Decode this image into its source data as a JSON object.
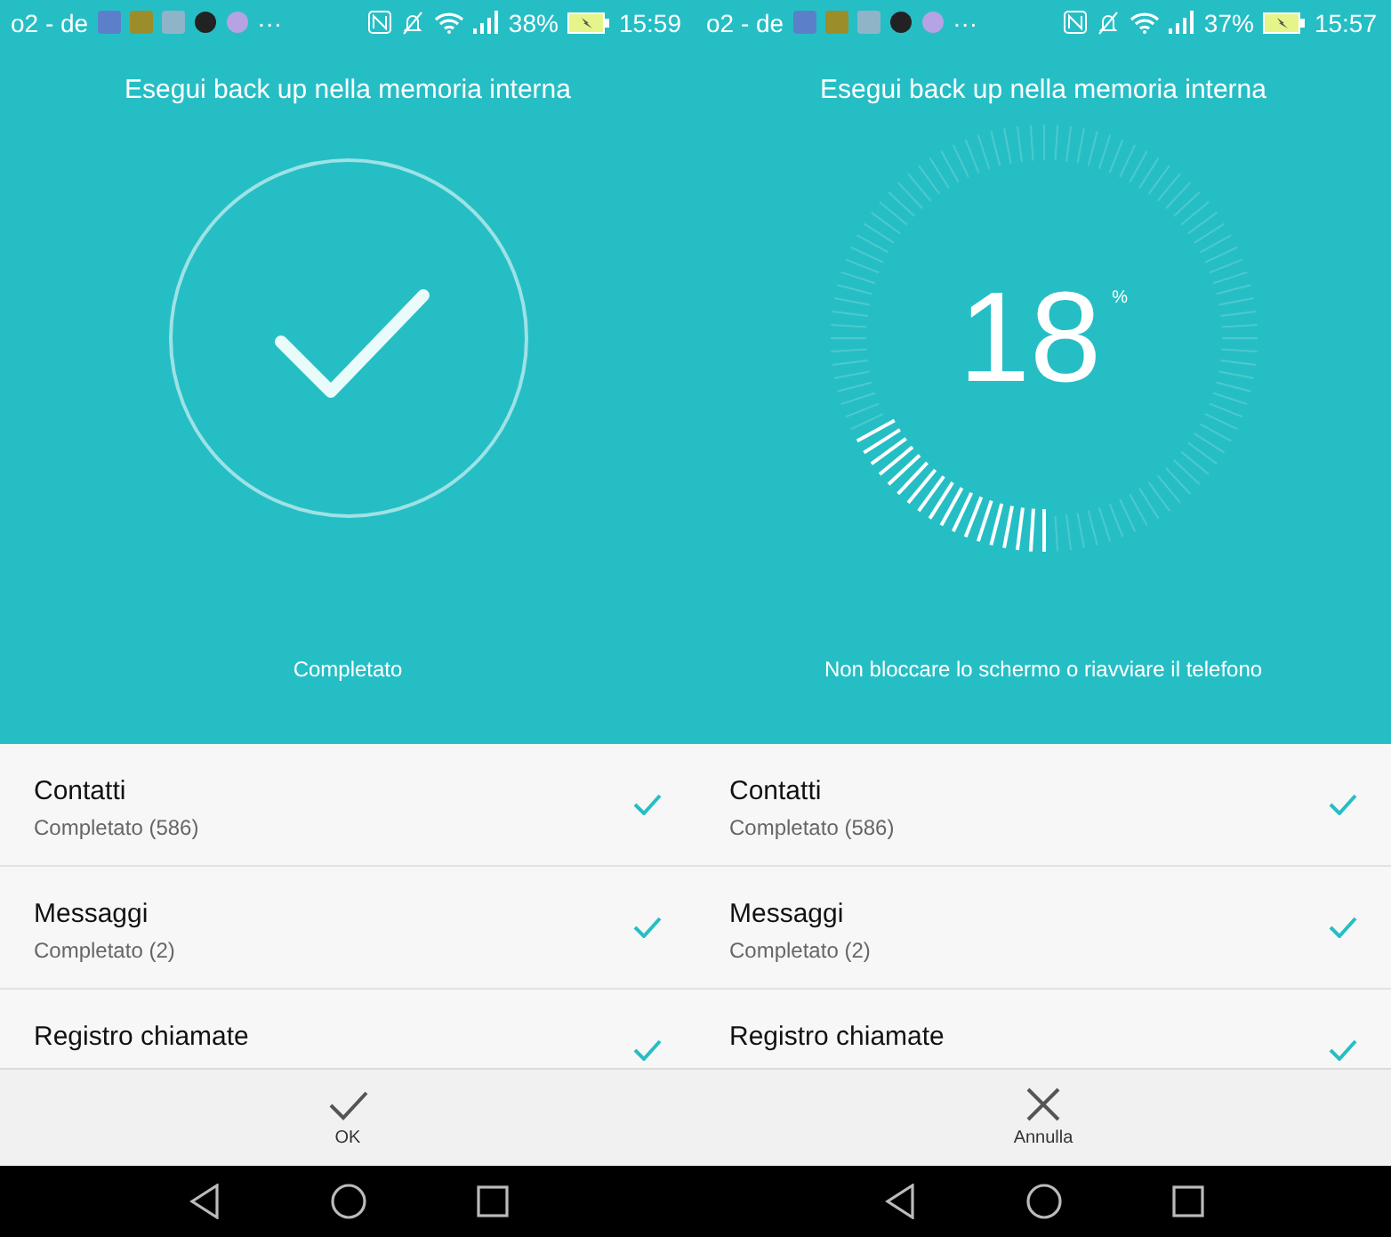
{
  "screens": [
    {
      "status_bar": {
        "carrier": "o2 - de",
        "overflow": "···",
        "battery": "38%",
        "time": "15:59"
      },
      "title": "Esegui back up nella memoria interna",
      "kind": "done",
      "caption": "Completato",
      "items": [
        {
          "title": "Contatti",
          "subtitle": "Completato (586)",
          "checked": true
        },
        {
          "title": "Messaggi",
          "subtitle": "Completato (2)",
          "checked": true
        },
        {
          "title": "Registro chiamate",
          "checked": true
        }
      ],
      "action": {
        "kind": "confirm",
        "label": "OK"
      }
    },
    {
      "status_bar": {
        "carrier": "o2 - de",
        "overflow": "···",
        "battery": "37%",
        "time": "15:57"
      },
      "title": "Esegui back up nella memoria interna",
      "kind": "progress",
      "progress": {
        "value": "18",
        "unit": "%",
        "level": 0.18
      },
      "caption": "Non bloccare lo schermo o riavviare il telefono",
      "items": [
        {
          "title": "Contatti",
          "subtitle": "Completato (586)",
          "checked": true
        },
        {
          "title": "Messaggi",
          "subtitle": "Completato (2)",
          "checked": true
        },
        {
          "title": "Registro chiamate",
          "checked": true
        }
      ],
      "action": {
        "kind": "cancel",
        "label": "Annulla"
      }
    }
  ]
}
